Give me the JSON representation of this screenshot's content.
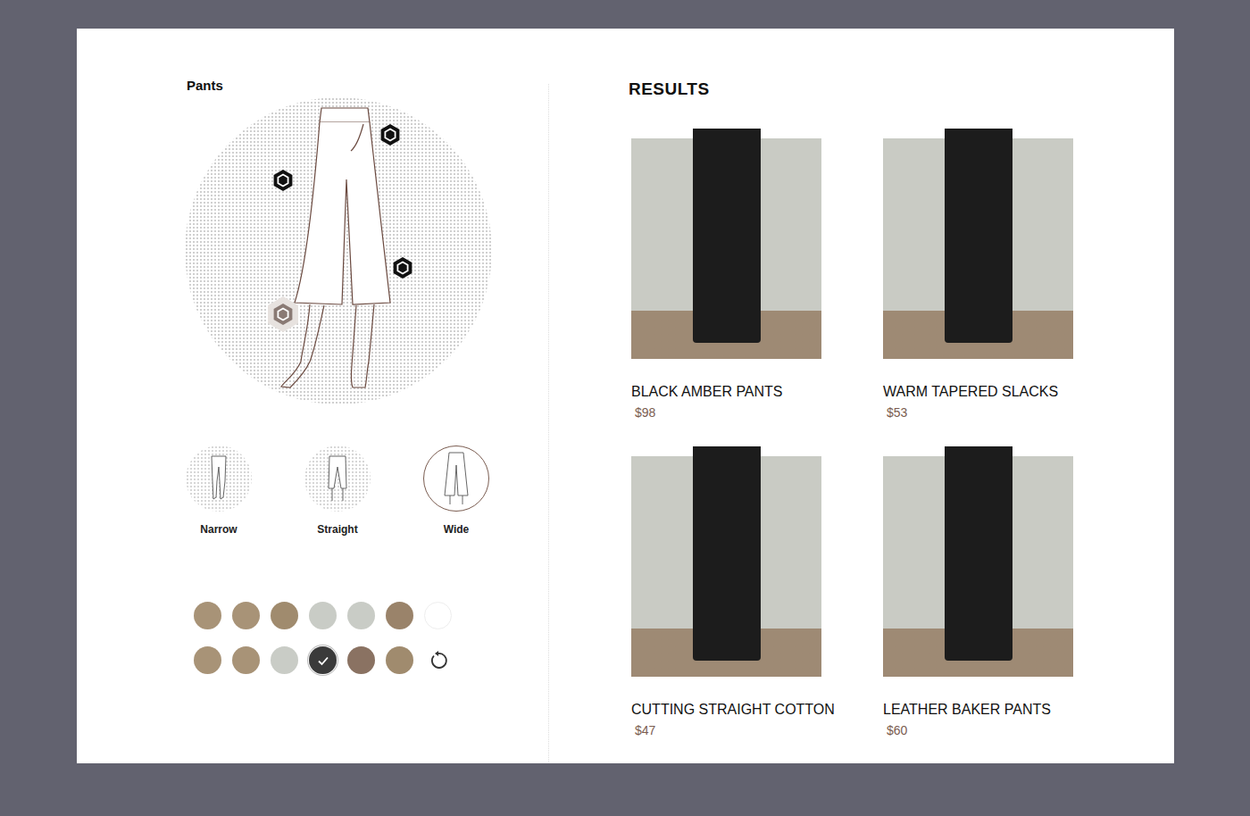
{
  "panel": {
    "title": "Pants"
  },
  "pins": [
    {
      "selected": false
    },
    {
      "selected": false
    },
    {
      "selected": false
    },
    {
      "selected": true
    }
  ],
  "fits": [
    {
      "label": "Narrow",
      "kind": "narrow",
      "selected": false
    },
    {
      "label": "Straight",
      "kind": "straight",
      "selected": false
    },
    {
      "label": "Wide",
      "kind": "wide",
      "selected": true
    }
  ],
  "swatches": [
    {
      "color": "#a89377",
      "selected": false
    },
    {
      "color": "#a89377",
      "selected": false
    },
    {
      "color": "#a08b6e",
      "selected": false
    },
    {
      "color": "#c9ccc6",
      "selected": false
    },
    {
      "color": "#c9ccc6",
      "selected": false
    },
    {
      "color": "#9a836a",
      "selected": false
    },
    {
      "color": "#ffffff",
      "selected": false
    },
    {
      "color": "#a89377",
      "selected": false
    },
    {
      "color": "#a89377",
      "selected": false
    },
    {
      "color": "#c9ccc6",
      "selected": false
    },
    {
      "color": "#3a3a3a",
      "selected": true
    },
    {
      "color": "#8a7262",
      "selected": false
    },
    {
      "color": "#a08b6e",
      "selected": false
    }
  ],
  "results": {
    "title": "RESULTS",
    "products": [
      {
        "name": "BLACK AMBER PANTS",
        "price": "$98"
      },
      {
        "name": "WARM TAPERED SLACKS",
        "price": "$53"
      },
      {
        "name": "CUTTING STRAIGHT COTTON",
        "price": "$47"
      },
      {
        "name": "LEATHER BAKER PANTS",
        "price": "$60"
      }
    ]
  }
}
